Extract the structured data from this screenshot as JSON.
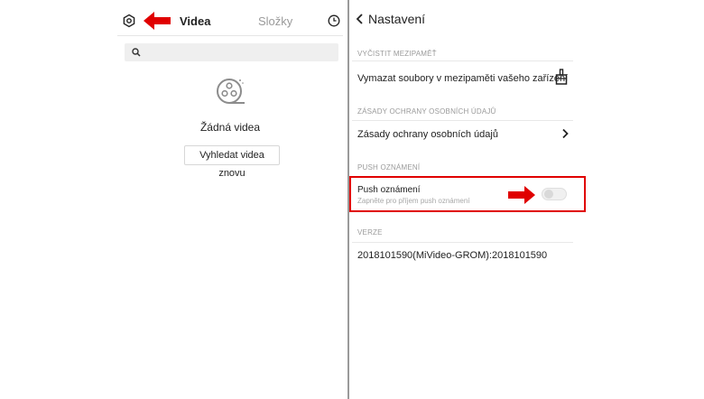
{
  "left_screen": {
    "tabs": [
      {
        "label": "Videa",
        "active": true
      },
      {
        "label": "Složky",
        "active": false
      }
    ],
    "icons": {
      "settings": "gear-icon",
      "history": "clock-icon",
      "search": "search-icon",
      "empty": "film-reel-icon",
      "annotation": "red-arrow-icon"
    },
    "search": {
      "placeholder": "",
      "value": ""
    },
    "empty_state": {
      "title": "Žádná videa",
      "button_label": "Vyhledat videa znovu"
    }
  },
  "right_screen": {
    "header": {
      "title": "Nastavení"
    },
    "sections": [
      {
        "heading": "VYČISTIT MEZIPAMĚŤ",
        "item": "Vymazat soubory v mezipaměti vašeho zařízení",
        "icon": "brush-icon"
      },
      {
        "heading": "ZÁSADY OCHRANY OSOBNÍCH ÚDAJŮ",
        "item": "Zásady ochrany osobních údajů",
        "icon": "chevron-right-icon"
      },
      {
        "heading": "PUSH OZNÁMENÍ",
        "item": "Push oznámení",
        "subtitle": "Zapněte pro příjem push oznámení",
        "toggle_on": false
      },
      {
        "heading": "VERZE",
        "item": "2018101590(MiVideo-GROM):2018101590"
      }
    ]
  },
  "colors": {
    "annotation_red": "#e00000",
    "divider": "#9a9a9a",
    "muted_text": "#9a9a9a"
  }
}
